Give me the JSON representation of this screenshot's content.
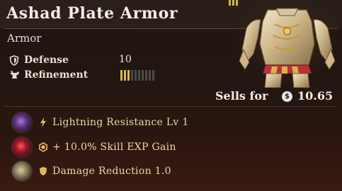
{
  "item": {
    "name": "Ashad Plate Armor",
    "category": "Armor",
    "stats": {
      "defense_label": "Defense",
      "defense_value": "10",
      "refinement_label": "Refinement",
      "refinement_level": 3,
      "refinement_max": 10
    },
    "sells_label": "Sells for",
    "sells_value": "10.65",
    "currency_icon": "coin-icon",
    "effects": [
      {
        "icon": "lightning-icon",
        "gem": "purple-gem-icon",
        "text": "Lightning Resistance Lv 1"
      },
      {
        "icon": "skill-exp-icon",
        "gem": "red-gem-icon",
        "text": "+ 10.0% Skill EXP Gain"
      },
      {
        "icon": "shield-icon",
        "gem": "gold-gem-icon",
        "text": "Damage Reduction 1.0"
      }
    ]
  },
  "colors": {
    "accent_gold": "#d9b94a",
    "effect_text": "#ecd9a6",
    "title_text": "#f4ede1"
  }
}
